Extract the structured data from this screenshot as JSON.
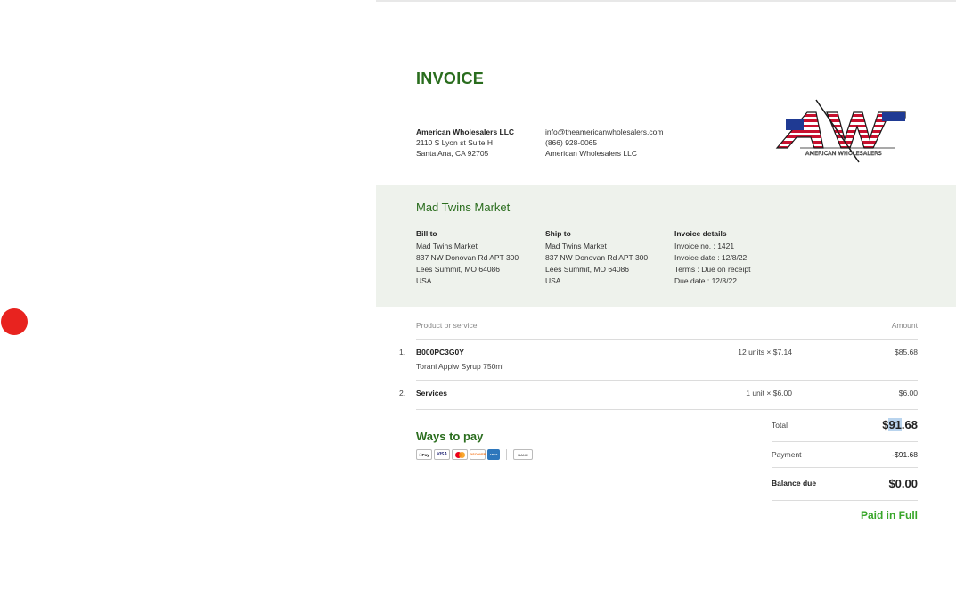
{
  "invoice": {
    "title": "INVOICE",
    "seller": {
      "name": "American Wholesalers LLC",
      "address1": "2110 S Lyon st Suite H",
      "address2": "Santa Ana, CA 92705",
      "email": "info@theamericanwholesalers.com",
      "phone": "(866) 928-0065",
      "company": "American Wholesalers LLC",
      "logo_text": "AMERICAN WHOLESALERS"
    },
    "customer_name": "Mad Twins Market",
    "bill_to": {
      "heading": "Bill to",
      "lines": [
        "Mad Twins Market",
        "837 NW Donovan Rd APT 300",
        "Lees Summit, MO 64086",
        "USA"
      ]
    },
    "ship_to": {
      "heading": "Ship to",
      "lines": [
        "Mad Twins Market",
        "837 NW Donovan Rd APT 300",
        "Lees Summit, MO 64086",
        "USA"
      ]
    },
    "details": {
      "heading": "Invoice details",
      "lines": [
        "Invoice no. : 1421",
        "Invoice date : 12/8/22",
        "Terms : Due on receipt",
        "Due date : 12/8/22"
      ]
    },
    "table": {
      "col_product": "Product or service",
      "col_amount": "Amount",
      "items": [
        {
          "num": "1.",
          "sku": "B000PC3G0Y",
          "desc": "Torani Applw Syrup 750ml",
          "qty": "12 units × $7.14",
          "amount": "$85.68"
        },
        {
          "num": "2.",
          "sku": "Services",
          "desc": "",
          "qty": "1 unit × $6.00",
          "amount": "$6.00"
        }
      ]
    },
    "ways_to_pay": "Ways to pay",
    "payment_methods": [
      "Pay",
      "VISA",
      "DISCOVER",
      "AMEX",
      "BANK"
    ],
    "summary": {
      "total_label": "Total",
      "total_a": "$",
      "total_b": "91",
      "total_c": ".68",
      "payment_label": "Payment",
      "payment_value": "-$91.68",
      "due_label": "Balance due",
      "due_value": "$0.00",
      "status": "Paid in Full"
    }
  }
}
